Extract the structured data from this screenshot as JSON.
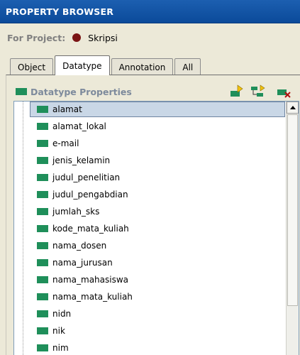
{
  "window": {
    "title": "PROPERTY BROWSER"
  },
  "project": {
    "label": "For Project:",
    "name": "Skripsi",
    "icon": "project-dot-icon"
  },
  "tabs": [
    {
      "label": "Object",
      "active": false
    },
    {
      "label": "Datatype",
      "active": true
    },
    {
      "label": "Annotation",
      "active": false
    },
    {
      "label": "All",
      "active": false
    }
  ],
  "section": {
    "title": "Datatype Properties",
    "icon": "datatype-property-icon",
    "tools": [
      "add-property-icon",
      "add-subproperty-icon",
      "delete-property-icon"
    ]
  },
  "properties": {
    "selected_index": 0,
    "items": [
      "alamat",
      "alamat_lokal",
      "e-mail",
      "jenis_kelamin",
      "judul_penelitian",
      "judul_pengabdian",
      "jumlah_sks",
      "kode_mata_kuliah",
      "nama_dosen",
      "nama_jurusan",
      "nama_mahasiswa",
      "nama_mata_kuliah",
      "nidn",
      "nik",
      "nim"
    ]
  },
  "colors": {
    "titlebar": "#0b4a9a",
    "property_icon": "#1f8f5a",
    "project_icon": "#7a1414",
    "selection": "#c9d7e6"
  }
}
